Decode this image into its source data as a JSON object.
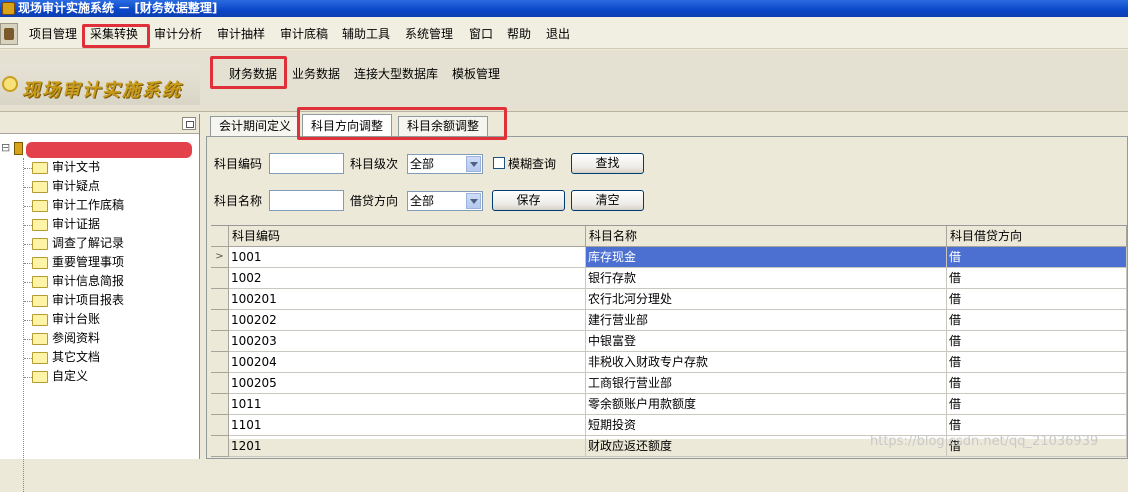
{
  "window": {
    "title": "现场审计实施系统 － [财务数据整理]"
  },
  "menubar": {
    "items": [
      "项目管理",
      "采集转换",
      "审计分析",
      "审计抽样",
      "审计底稿",
      "辅助工具",
      "系统管理",
      "窗口",
      "帮助",
      "退出"
    ]
  },
  "banner": {
    "logo_text": "现场审计实施系统"
  },
  "subnav": {
    "items": [
      "财务数据",
      "业务数据",
      "连接大型数据库",
      "模板管理"
    ]
  },
  "tree": {
    "items": [
      "审计文书",
      "审计疑点",
      "审计工作底稿",
      "审计证据",
      "调查了解记录",
      "重要管理事项",
      "审计信息简报",
      "审计项目报表",
      "审计台账",
      "参阅资料",
      "其它文档",
      "自定义"
    ]
  },
  "tabs": [
    "会计期间定义",
    "科目方向调整",
    "科目余额调整"
  ],
  "form": {
    "code_label": "科目编码",
    "level_label": "科目级次",
    "level_value": "全部",
    "fuzzy_label": "模糊查询",
    "search_button": "查找",
    "name_label": "科目名称",
    "direction_label": "借贷方向",
    "direction_value": "全部",
    "save_button": "保存",
    "clear_button": "清空"
  },
  "grid": {
    "columns": [
      "科目编码",
      "科目名称",
      "科目借贷方向"
    ],
    "rows": [
      [
        "1001",
        "库存现金",
        "借"
      ],
      [
        "1002",
        "银行存款",
        "借"
      ],
      [
        "100201",
        "农行北河分理处",
        "借"
      ],
      [
        "100202",
        "建行营业部",
        "借"
      ],
      [
        "100203",
        "中银富登",
        "借"
      ],
      [
        "100204",
        "非税收入财政专户存款",
        "借"
      ],
      [
        "100205",
        "工商银行营业部",
        "借"
      ],
      [
        "1011",
        "零余额账户用款额度",
        "借"
      ],
      [
        "1101",
        "短期投资",
        "借"
      ],
      [
        "1201",
        "财政应返还额度",
        "借"
      ]
    ],
    "current_row_marker": ">"
  },
  "watermark": "https://blog.csdn.net/qq_21036939",
  "colors": {
    "highlight": "#e0303a",
    "selection": "#4c70d2",
    "titlebar": "#0a46c8"
  }
}
